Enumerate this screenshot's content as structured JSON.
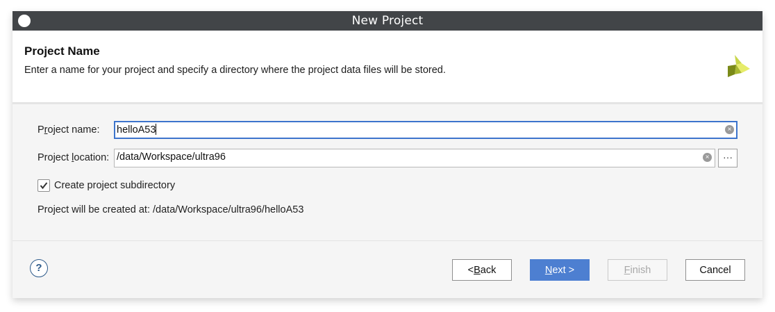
{
  "window": {
    "title": "New Project"
  },
  "header": {
    "title": "Project Name",
    "description": "Enter a name for your project and specify a directory where the project data files will be stored.",
    "logo_icon": "xilinx-logo-icon"
  },
  "form": {
    "project_name": {
      "label_prefix": "P",
      "label_ul": "r",
      "label_suffix": "oject name:",
      "value": "helloA53"
    },
    "project_location": {
      "label_prefix": "Project ",
      "label_ul": "l",
      "label_suffix": "ocation:",
      "value": "/data/Workspace/ultra96",
      "browse_label": "···"
    },
    "subdirectory": {
      "label": "Create project subdirectory",
      "checked": true
    },
    "created_at": "Project will be created at: /data/Workspace/ultra96/helloA53"
  },
  "footer": {
    "help_label": "?",
    "back": {
      "prefix": "< ",
      "ul": "B",
      "suffix": "ack"
    },
    "next": {
      "prefix": "",
      "ul": "N",
      "suffix": "ext >"
    },
    "finish": {
      "prefix": "",
      "ul": "F",
      "suffix": "inish"
    },
    "cancel": "Cancel"
  },
  "colors": {
    "titlebar": "#424548",
    "accent": "#4d7fd1",
    "focus": "#3c74cc"
  }
}
